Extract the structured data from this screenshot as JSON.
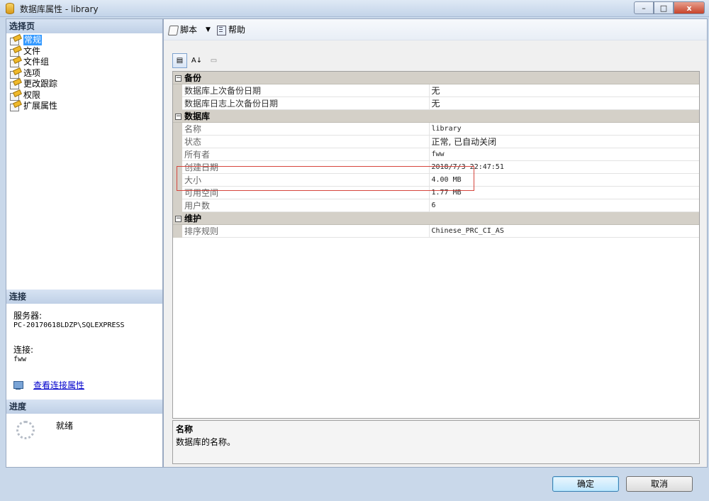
{
  "window": {
    "title": "数据库属性 - library",
    "controls": {
      "minimize": "–",
      "maximize": "□",
      "close": "x"
    }
  },
  "left_pane": {
    "select_page": {
      "header": "选择页",
      "items": [
        {
          "label": "常规",
          "selected": true
        },
        {
          "label": "文件",
          "selected": false
        },
        {
          "label": "文件组",
          "selected": false
        },
        {
          "label": "选项",
          "selected": false
        },
        {
          "label": "更改跟踪",
          "selected": false
        },
        {
          "label": "权限",
          "selected": false
        },
        {
          "label": "扩展属性",
          "selected": false
        }
      ]
    },
    "connection": {
      "header": "连接",
      "server_label": "服务器:",
      "server_value": "PC-20170618LDZP\\SQLEXPRESS",
      "connection_label": "连接:",
      "connection_value": "fww",
      "view_link": "查看连接属性"
    },
    "progress": {
      "header": "进度",
      "status": "就绪"
    }
  },
  "toolbar": {
    "script_label": "脚本",
    "dropdown_arrow": "▼",
    "help_label": "帮助"
  },
  "property_toolbar": {
    "categorized": "▤",
    "alphabetical": "A↓"
  },
  "property_grid": {
    "toggle_symbol": "⊟",
    "categories": [
      {
        "name": "备份",
        "properties": [
          {
            "name": "数据库上次备份日期",
            "value": "无"
          },
          {
            "name": "数据库日志上次备份日期",
            "value": "无"
          }
        ]
      },
      {
        "name": "数据库",
        "properties": [
          {
            "name": "名称",
            "value": "library"
          },
          {
            "name": "状态",
            "value": "正常, 已自动关闭"
          },
          {
            "name": "所有者",
            "value": "fww"
          },
          {
            "name": "创建日期",
            "value": "2018/7/3 22:47:51"
          },
          {
            "name": "大小",
            "value": "4.00 MB"
          },
          {
            "name": "可用空间",
            "value": "1.77 MB"
          },
          {
            "name": "用户数",
            "value": "6"
          }
        ]
      },
      {
        "name": "维护",
        "properties": [
          {
            "name": "排序规则",
            "value": "Chinese_PRC_CI_AS"
          }
        ]
      }
    ]
  },
  "description": {
    "title": "名称",
    "text": "数据库的名称。"
  },
  "buttons": {
    "ok": "确定",
    "cancel": "取消"
  },
  "colors": {
    "selection": "#3399ff",
    "highlight_box": "#d6453d",
    "category_bg": "#d4d0c8"
  }
}
